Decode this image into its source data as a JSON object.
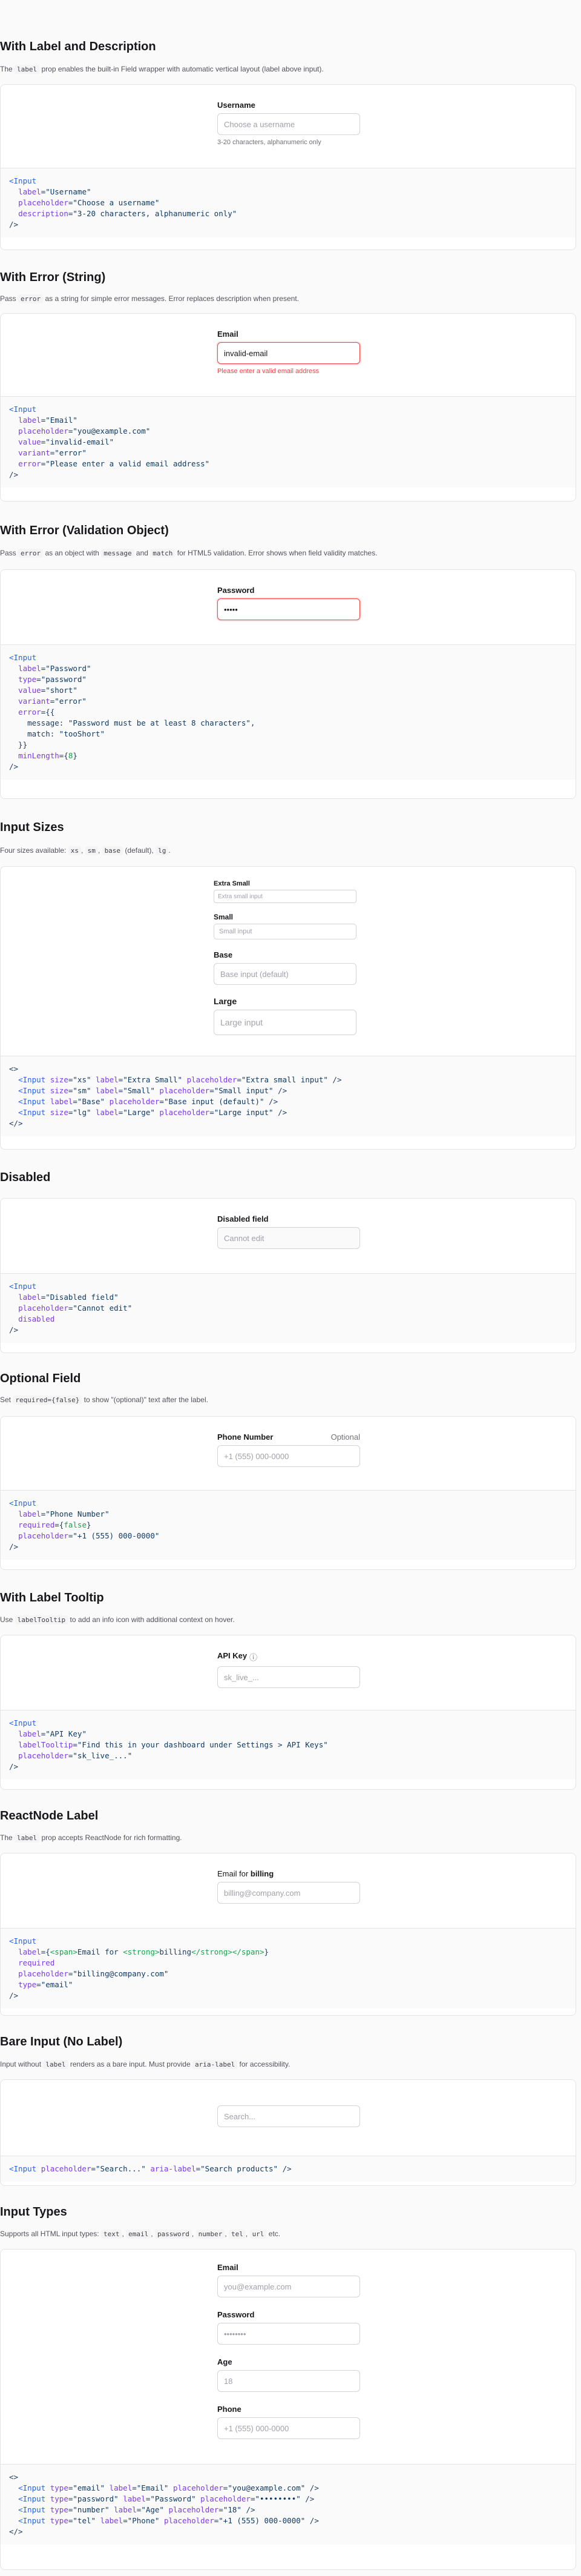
{
  "s1": {
    "title": "With Label and Description",
    "desc_pre": "The ",
    "desc_code": "label",
    "desc_post": " prop enables the built-in Field wrapper with automatic vertical layout (label above input).",
    "label": "Username",
    "placeholder": "Choose a username",
    "help": "3-20 characters, alphanumeric only",
    "code": [
      "<Input",
      "  label=\"Username\"",
      "  placeholder=\"Choose a username\"",
      "  description=\"3-20 characters, alphanumeric only\"",
      "/>"
    ]
  },
  "s2": {
    "title": "With Error (String)",
    "desc_pre": "Pass ",
    "desc_code": "error",
    "desc_post": " as a string for simple error messages. Error replaces description when present.",
    "label": "Email",
    "value": "invalid-email",
    "error": "Please enter a valid email address",
    "code": [
      "<Input",
      "  label=\"Email\"",
      "  placeholder=\"you@example.com\"",
      "  value=\"invalid-email\"",
      "  variant=\"error\"",
      "  error=\"Please enter a valid email address\"",
      "/>"
    ]
  },
  "s3": {
    "title": "With Error (Validation Object)",
    "desc_pre": "Pass ",
    "desc_code": "error",
    "desc_mid1": " as an object with ",
    "desc_code2": "message",
    "desc_mid2": " and ",
    "desc_code3": "match",
    "desc_post": " for HTML5 validation. Error shows when field validity matches.",
    "label": "Password",
    "value": "•••••",
    "code": [
      "<Input",
      "  label=\"Password\"",
      "  type=\"password\"",
      "  value=\"short\"",
      "  variant=\"error\"",
      "  error={{",
      "    message: \"Password must be at least 8 characters\",",
      "    match: \"tooShort\"",
      "  }}",
      "  minLength={8}",
      "/>"
    ]
  },
  "s4": {
    "title": "Input Sizes",
    "desc_pre": "Four sizes available: ",
    "desc_code": "xs",
    "desc_code2": "sm",
    "desc_code3": "base",
    "desc_mid": " (default), ",
    "desc_code4": "lg",
    "desc_post": ".",
    "xs_label": "Extra Small",
    "xs_placeholder": "Extra small input",
    "sm_label": "Small",
    "sm_placeholder": "Small input",
    "base_label": "Base",
    "base_placeholder": "Base input (default)",
    "lg_label": "Large",
    "lg_placeholder": "Large input",
    "code": [
      "<>",
      "  <Input size=\"xs\" label=\"Extra Small\" placeholder=\"Extra small input\" />",
      "  <Input size=\"sm\" label=\"Small\" placeholder=\"Small input\" />",
      "  <Input label=\"Base\" placeholder=\"Base input (default)\" />",
      "  <Input size=\"lg\" label=\"Large\" placeholder=\"Large input\" />",
      "</>"
    ]
  },
  "s5": {
    "title": "Disabled",
    "label": "Disabled field",
    "placeholder": "Cannot edit",
    "code": [
      "<Input",
      "  label=\"Disabled field\"",
      "  placeholder=\"Cannot edit\"",
      "  disabled",
      "/>"
    ]
  },
  "s6": {
    "title": "Optional Field",
    "desc_pre": "Set ",
    "desc_code": "required={false}",
    "desc_post": " to show \"(optional)\" text after the label.",
    "label": "Phone Number",
    "optional": "Optional",
    "placeholder": "+1 (555) 000-0000",
    "code": [
      "<Input",
      "  label=\"Phone Number\"",
      "  required={false}",
      "  placeholder=\"+1 (555) 000-0000\"",
      "/>"
    ]
  },
  "s7": {
    "title": "With Label Tooltip",
    "desc_pre": "Use ",
    "desc_code": "labelTooltip",
    "desc_post": " to add an info icon with additional context on hover.",
    "label": "API Key",
    "info_glyph": "ⓘ",
    "placeholder": "sk_live_...",
    "code": [
      "<Input",
      "  label=\"API Key\"",
      "  labelTooltip=\"Find this in your dashboard under Settings > API Keys\"",
      "  placeholder=\"sk_live_...\"",
      "/>"
    ]
  },
  "s8": {
    "title": "ReactNode Label",
    "desc_pre": "The ",
    "desc_code": "label",
    "desc_post": " prop accepts ReactNode for rich formatting.",
    "label_pre": "Email for ",
    "label_strong": "billing",
    "placeholder": "billing@company.com",
    "code": [
      "<Input",
      "  label={<span>Email for <strong>billing</strong></span>}",
      "  required",
      "  placeholder=\"billing@company.com\"",
      "  type=\"email\"",
      "/>"
    ]
  },
  "s9": {
    "title": "Bare Input (No Label)",
    "desc_pre": "Input without ",
    "desc_code": "label",
    "desc_mid": " renders as a bare input. Must provide ",
    "desc_code2": "aria-label",
    "desc_post": " for accessibility.",
    "placeholder": "Search...",
    "code": [
      "<Input placeholder=\"Search...\" aria-label=\"Search products\" />"
    ]
  },
  "s10": {
    "title": "Input Types",
    "desc_pre": "Supports all HTML input types: ",
    "types": [
      "text",
      "email",
      "password",
      "number",
      "tel",
      "url"
    ],
    "desc_post": " etc.",
    "email_label": "Email",
    "email_placeholder": "you@example.com",
    "password_label": "Password",
    "password_placeholder": "••••••••",
    "age_label": "Age",
    "age_placeholder": "18",
    "phone_label": "Phone",
    "phone_placeholder": "+1 (555) 000-0000",
    "code": [
      "<>",
      "  <Input type=\"email\" label=\"Email\" placeholder=\"you@example.com\" />",
      "  <Input type=\"password\" label=\"Password\" placeholder=\"••••••••\" />",
      "  <Input type=\"number\" label=\"Age\" placeholder=\"18\" />",
      "  <Input type=\"tel\" label=\"Phone\" placeholder=\"+1 (555) 000-0000\" />",
      "</>"
    ]
  }
}
